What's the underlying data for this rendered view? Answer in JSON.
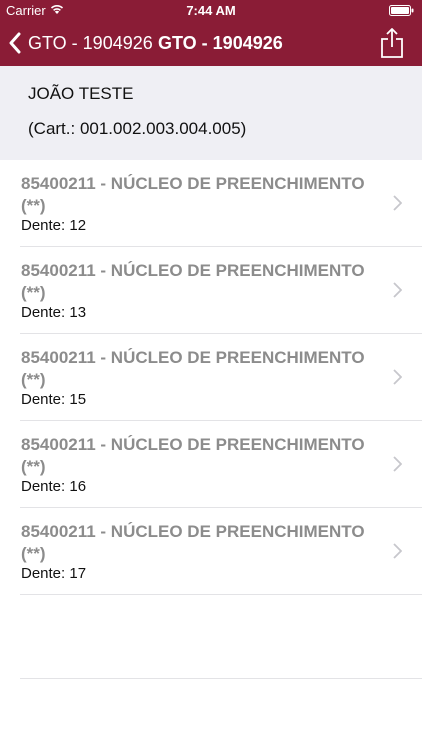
{
  "status_bar": {
    "carrier": "Carrier",
    "time": "7:44 AM"
  },
  "nav": {
    "back_label": "GTO - 1904926",
    "title": "GTO - 1904926"
  },
  "patient": {
    "name": "JOÃO TESTE",
    "card": "(Cart.: 001.002.003.004.005)"
  },
  "procedures": [
    {
      "title": "85400211 - NÚCLEO DE PREENCHIMENTO (**)",
      "tooth": "Dente: 12"
    },
    {
      "title": "85400211 - NÚCLEO DE PREENCHIMENTO (**)",
      "tooth": "Dente: 13"
    },
    {
      "title": "85400211 - NÚCLEO DE PREENCHIMENTO (**)",
      "tooth": "Dente: 15"
    },
    {
      "title": "85400211 - NÚCLEO DE PREENCHIMENTO (**)",
      "tooth": "Dente: 16"
    },
    {
      "title": "85400211 - NÚCLEO DE PREENCHIMENTO (**)",
      "tooth": "Dente: 17"
    }
  ],
  "colors": {
    "nav_background": "#8a1c36",
    "header_background": "#efeff4",
    "title_text": "#8c8c8c"
  }
}
